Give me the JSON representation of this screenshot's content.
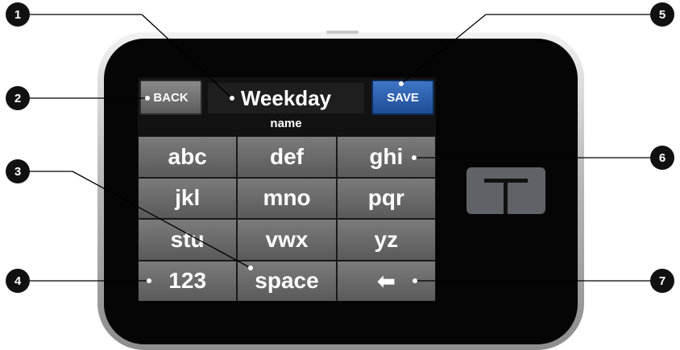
{
  "header": {
    "back_label": "BACK",
    "save_label": "SAVE",
    "name_value": "Weekday",
    "name_caption": "name"
  },
  "keypad": {
    "keys": [
      "abc",
      "def",
      "ghi",
      "jkl",
      "mno",
      "pqr",
      "stu",
      "vwx",
      "yz",
      "123",
      "space",
      "⬅"
    ]
  },
  "callouts": [
    "1",
    "2",
    "3",
    "4",
    "5",
    "6",
    "7"
  ],
  "colors": {
    "save_button": "#2b5fae",
    "keys": "#6b6b6b",
    "bezel": "#050505"
  },
  "icons": {
    "backspace": "left-arrow-icon",
    "device_logo": "t-logo-icon"
  }
}
